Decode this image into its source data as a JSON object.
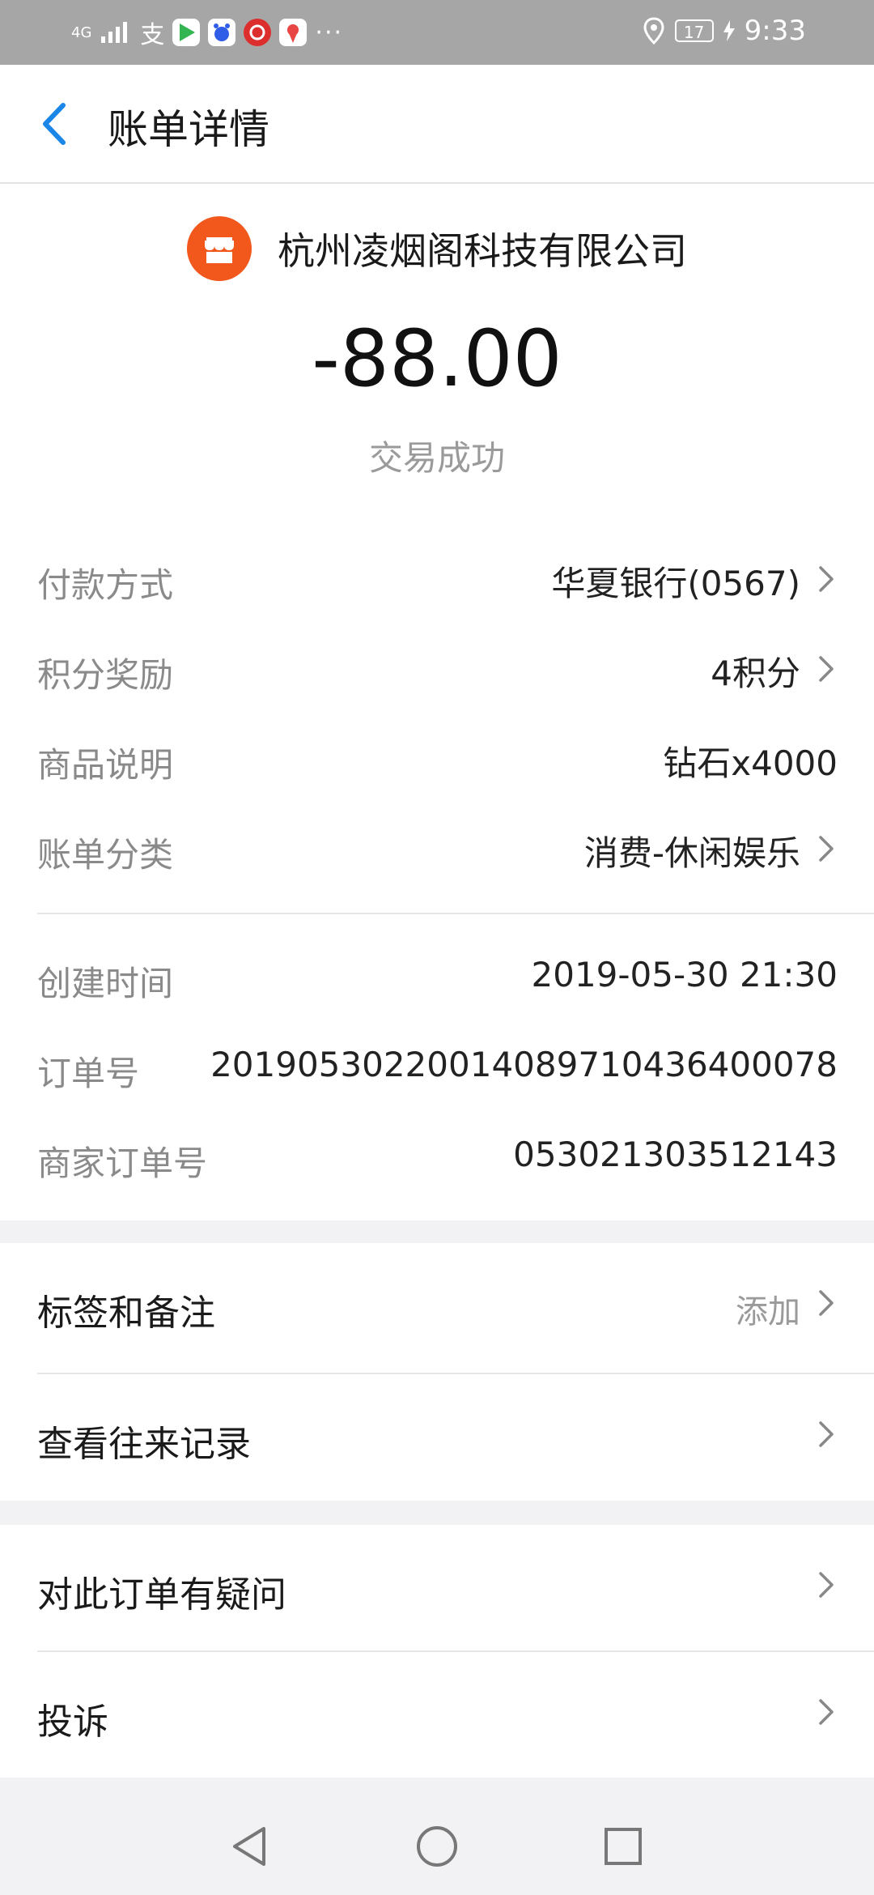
{
  "status_bar": {
    "network": "4G",
    "time": "9:33",
    "battery": "17",
    "more": "···"
  },
  "header": {
    "title": "账单详情"
  },
  "summary": {
    "merchant": "杭州凌烟阁科技有限公司",
    "amount": "-88.00",
    "status": "交易成功"
  },
  "details": [
    {
      "label": "付款方式",
      "value": "华夏银行(0567)",
      "arrow": true
    },
    {
      "label": "积分奖励",
      "value": "4积分",
      "arrow": true
    },
    {
      "label": "商品说明",
      "value": "钻石x4000",
      "arrow": false
    },
    {
      "label": "账单分类",
      "value": "消费-休闲娱乐",
      "arrow": true
    }
  ],
  "order_info": [
    {
      "label": "创建时间",
      "value": "2019-05-30 21:30"
    },
    {
      "label": "订单号",
      "value": "20190530220014089710436400078"
    },
    {
      "label": "商家订单号",
      "value": "053021303512143"
    }
  ],
  "actions_1": [
    {
      "label": "标签和备注",
      "extra": "添加"
    },
    {
      "label": "查看往来记录",
      "extra": ""
    }
  ],
  "actions_2": [
    {
      "label": "对此订单有疑问"
    },
    {
      "label": "投诉"
    }
  ],
  "colors": {
    "accent": "#1a86e8",
    "merchant_logo": "#f2571c",
    "label_gray": "#8a8a8a"
  },
  "icons": {
    "back": "chevron-left-icon",
    "row_arrow": "chevron-right-icon",
    "nav_back": "triangle-back-icon",
    "nav_home": "circle-home-icon",
    "nav_recent": "square-recent-icon"
  }
}
